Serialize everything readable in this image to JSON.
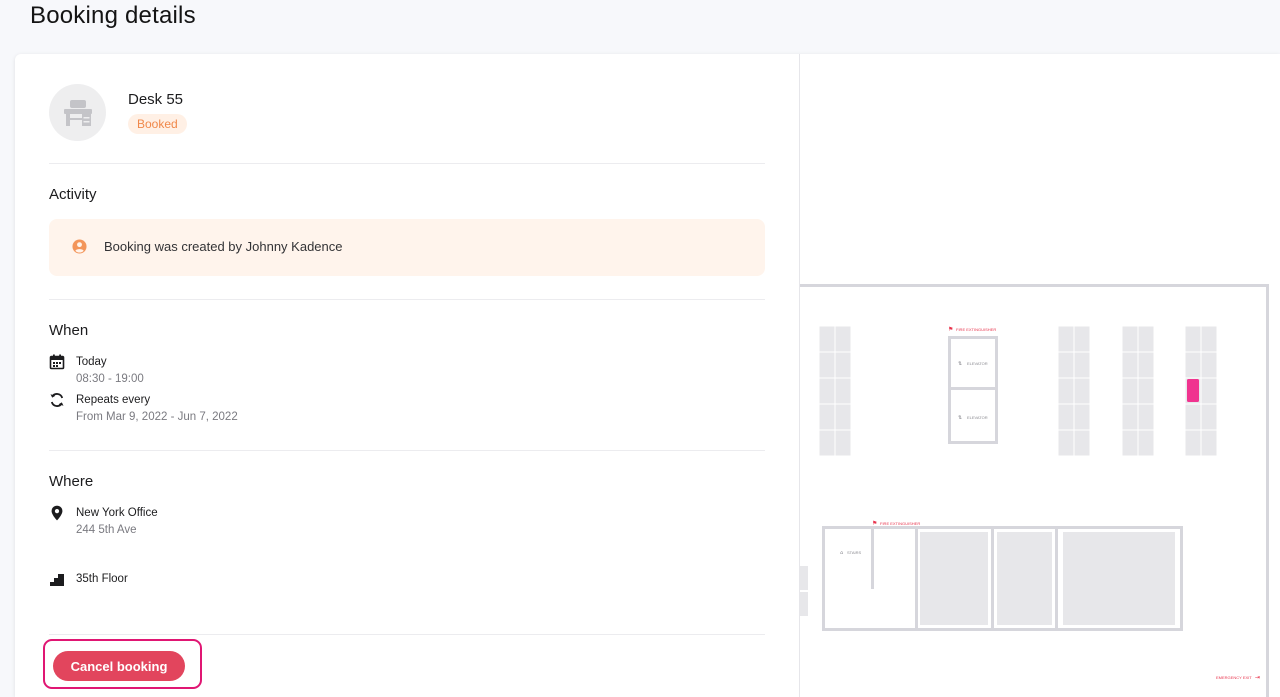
{
  "page": {
    "title": "Booking details"
  },
  "resource": {
    "name": "Desk 55",
    "status": "Booked",
    "icon": "desk-icon"
  },
  "activity": {
    "heading": "Activity",
    "entries": [
      {
        "icon": "user-circle-icon",
        "text": "Booking was created by Johnny Kadence"
      }
    ]
  },
  "when": {
    "heading": "When",
    "date_label": "Today",
    "time_range": "08:30 - 19:00",
    "repeat_label": "Repeats every",
    "repeat_range": "From Mar 9, 2022 - Jun 7, 2022"
  },
  "where": {
    "heading": "Where",
    "office_name": "New York Office",
    "office_address": "244 5th Ave",
    "floor": "35th Floor"
  },
  "actions": {
    "cancel_label": "Cancel booking"
  },
  "floorplan": {
    "labels": {
      "fire_extinguisher": "FIRE EXTINGUISHER",
      "elevator": "ELEVATOR",
      "stairs": "STAIRS",
      "emergency_exit": "EMERGENCY EXIT"
    },
    "colors": {
      "selected_desk": "#f0338f",
      "desk": "#e7e7ea",
      "wall": "#d6d6dc",
      "label_red": "#e8334c"
    }
  }
}
